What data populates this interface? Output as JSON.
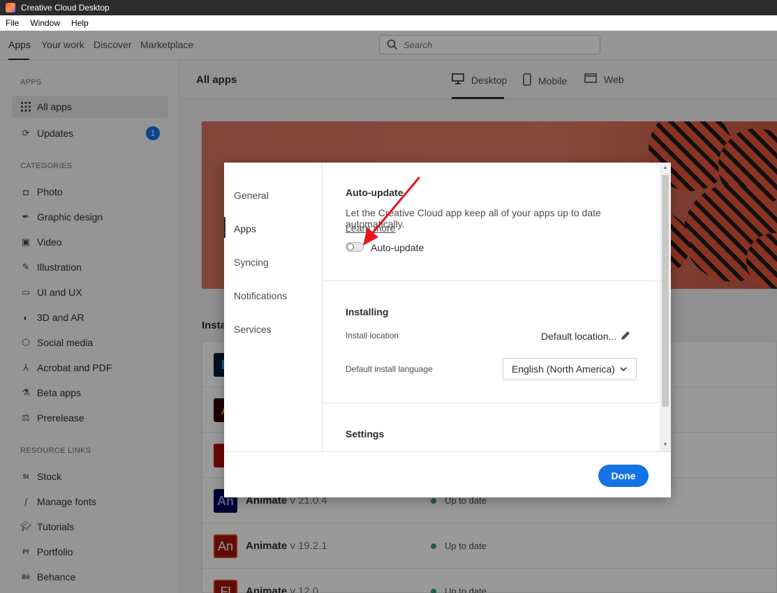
{
  "window": {
    "title": "Creative Cloud Desktop"
  },
  "menu": [
    "File",
    "Window",
    "Help"
  ],
  "topnav": {
    "tabs": [
      "Apps",
      "Your work",
      "Discover",
      "Marketplace"
    ],
    "search_placeholder": "Search"
  },
  "sidebar": {
    "apps_heading": "APPS",
    "all_apps": "All apps",
    "updates": "Updates",
    "updates_count": "1",
    "categories_heading": "CATEGORIES",
    "categories": [
      "Photo",
      "Graphic design",
      "Video",
      "Illustration",
      "UI and UX",
      "3D and AR",
      "Social media",
      "Acrobat and PDF",
      "Beta apps",
      "Prerelease"
    ],
    "resources_heading": "RESOURCE LINKS",
    "resources": [
      "Stock",
      "Manage fonts",
      "Tutorials",
      "Portfolio",
      "Behance"
    ]
  },
  "main": {
    "title": "All apps",
    "view_tabs": [
      "Desktop",
      "Mobile",
      "Web"
    ],
    "installed_label": "Insta",
    "apps": [
      {
        "icon": "P",
        "name": "",
        "version": "",
        "status": ""
      },
      {
        "icon": "A",
        "name": "",
        "version": "",
        "status": ""
      },
      {
        "icon": "",
        "name": "",
        "version": "",
        "status": ""
      },
      {
        "icon": "An",
        "name": "Animate",
        "version": "v 21.0.4",
        "status": "Up to date"
      },
      {
        "icon": "An",
        "name": "Animate",
        "version": "v 19.2.1",
        "status": "Up to date"
      },
      {
        "icon": "Fl",
        "name": "Animate",
        "version": "v 12.0",
        "status": "Up to date"
      }
    ]
  },
  "modal": {
    "nav": [
      "General",
      "Apps",
      "Syncing",
      "Notifications",
      "Services"
    ],
    "active_nav": "Apps",
    "auto_update": {
      "title": "Auto-update",
      "description": "Let the Creative Cloud app keep all of your apps up to date automatically.",
      "learn_more": "Learn more",
      "toggle_label": "Auto-update",
      "toggle_on": false
    },
    "installing": {
      "title": "Installing",
      "install_location_label": "Install location",
      "install_location_value": "Default location...",
      "language_label": "Default install language",
      "language_value": "English (North America)"
    },
    "settings": {
      "title": "Settings"
    },
    "done_label": "Done"
  },
  "colors": {
    "accent": "#1473e6",
    "status_ok": "#2d9d78",
    "annotation_arrow": "#e8151b"
  }
}
